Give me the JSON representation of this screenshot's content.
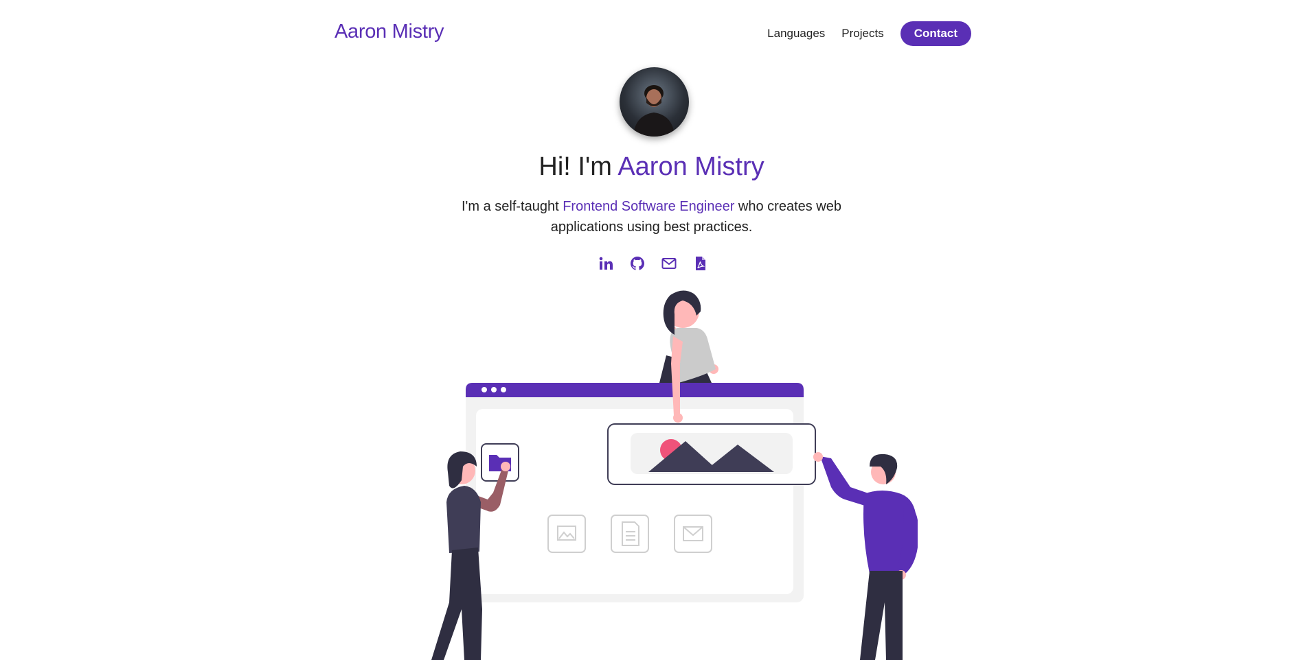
{
  "nav": {
    "brand": "Aaron Mistry",
    "links": [
      "Languages",
      "Projects"
    ],
    "contact": "Contact"
  },
  "hero": {
    "greeting": "Hi! I'm ",
    "name": "Aaron Mistry",
    "desc_before": "I'm a self-taught ",
    "desc_role": "Frontend Software Engineer",
    "desc_after": " who creates web applications using best practices."
  },
  "socials": [
    "linkedin-icon",
    "github-icon",
    "email-icon",
    "pdf-resume-icon"
  ],
  "colors": {
    "accent": "#5a2fb5",
    "text": "#222222",
    "illustration_dark": "#2f2e41",
    "illustration_skin": "#ffb8b8",
    "illustration_pink": "#f0537a"
  }
}
